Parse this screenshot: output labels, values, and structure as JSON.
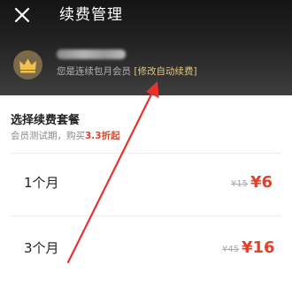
{
  "header": {
    "close_icon": "close-icon",
    "title": "续费管理"
  },
  "account": {
    "avatar_icon": "crown-icon",
    "member_text": "您是连续包月会员",
    "modify_link": "[修改自动续费]"
  },
  "plans_section": {
    "title": "选择续费套餐",
    "subtitle_prefix": "会员测试期，购买",
    "subtitle_discount": "3.3折起",
    "plans": [
      {
        "name": "1个月",
        "old_price": "¥15",
        "new_price": "¥6"
      },
      {
        "name": "3个月",
        "old_price": "¥45",
        "new_price": "¥16"
      }
    ]
  },
  "annotation": {
    "arrow_color": "#e8322e"
  },
  "colors": {
    "header_bg": "#1c1c1c",
    "gold_accent": "#e1c684",
    "price_red": "#e0432b"
  }
}
